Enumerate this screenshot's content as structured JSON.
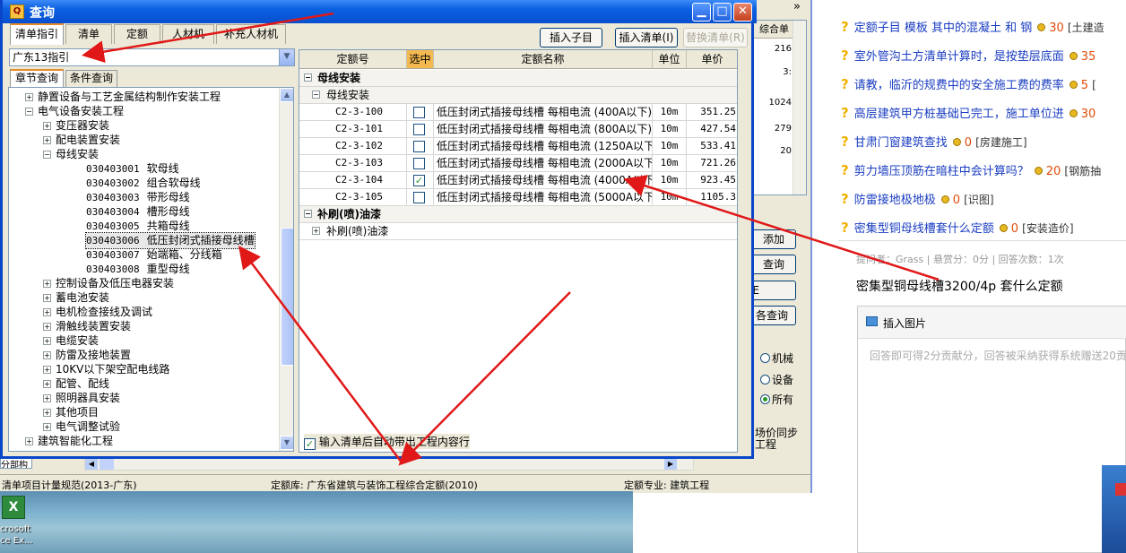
{
  "dialog": {
    "title": "查询",
    "tabs": [
      "清单指引",
      "清单",
      "定额",
      "人材机",
      "补充人材机"
    ],
    "buttons": {
      "insert_child": "插入子目",
      "insert_list": "插入清单(I)",
      "replace_list": "替换清单(R)"
    },
    "combo_value": "广东13指引",
    "subtabs": [
      "章节查询",
      "条件查询"
    ],
    "auto_check_label": "输入清单后自动带出工程内容行"
  },
  "tree": [
    {
      "label": "静置设备与工艺金属结构制作安装工程",
      "level": 1,
      "exp": "+"
    },
    {
      "label": "电气设备安装工程",
      "level": 1,
      "exp": "-"
    },
    {
      "label": "变压器安装",
      "level": 2,
      "exp": "+"
    },
    {
      "label": "配电装置安装",
      "level": 2,
      "exp": "+"
    },
    {
      "label": "母线安装",
      "level": 2,
      "exp": "-"
    },
    {
      "code": "030403001",
      "label": "软母线",
      "level": 3
    },
    {
      "code": "030403002",
      "label": "组合软母线",
      "level": 3
    },
    {
      "code": "030403003",
      "label": "带形母线",
      "level": 3
    },
    {
      "code": "030403004",
      "label": "槽形母线",
      "level": 3
    },
    {
      "code": "030403005",
      "label": "共箱母线",
      "level": 3
    },
    {
      "code": "030403006",
      "label": "低压封闭式插接母线槽",
      "level": 3,
      "selected": true
    },
    {
      "code": "030403007",
      "label": "始端箱、分线箱",
      "level": 3
    },
    {
      "code": "030403008",
      "label": "重型母线",
      "level": 3
    },
    {
      "label": "控制设备及低压电器安装",
      "level": 2,
      "exp": "+"
    },
    {
      "label": "蓄电池安装",
      "level": 2,
      "exp": "+"
    },
    {
      "label": "电机检查接线及调试",
      "level": 2,
      "exp": "+"
    },
    {
      "label": "滑触线装置安装",
      "level": 2,
      "exp": "+"
    },
    {
      "label": "电缆安装",
      "level": 2,
      "exp": "+"
    },
    {
      "label": "防雷及接地装置",
      "level": 2,
      "exp": "+"
    },
    {
      "label": "10KV以下架空配电线路",
      "level": 2,
      "exp": "+"
    },
    {
      "label": "配管、配线",
      "level": 2,
      "exp": "+"
    },
    {
      "label": "照明器具安装",
      "level": 2,
      "exp": "+"
    },
    {
      "label": "其他项目",
      "level": 2,
      "exp": "+"
    },
    {
      "label": "电气调整试验",
      "level": 2,
      "exp": "+"
    },
    {
      "label": "建筑智能化工程",
      "level": 1,
      "exp": "+"
    }
  ],
  "grid": {
    "headers": [
      "定额号",
      "选中",
      "定额名称",
      "单位",
      "单价"
    ],
    "group1": "母线安装",
    "subgroup1": "母线安装",
    "rows": [
      {
        "code": "C2-3-100",
        "checked": false,
        "name": "低压封闭式插接母线槽 每相电流 (400A以下)",
        "unit": "10m",
        "price": "351.25"
      },
      {
        "code": "C2-3-101",
        "checked": false,
        "name": "低压封闭式插接母线槽 每相电流 (800A以下)",
        "unit": "10m",
        "price": "427.54"
      },
      {
        "code": "C2-3-102",
        "checked": false,
        "name": "低压封闭式插接母线槽 每相电流 (1250A以下)",
        "unit": "10m",
        "price": "533.41"
      },
      {
        "code": "C2-3-103",
        "checked": false,
        "name": "低压封闭式插接母线槽 每相电流 (2000A以下)",
        "unit": "10m",
        "price": "721.26"
      },
      {
        "code": "C2-3-104",
        "checked": true,
        "name": "低压封闭式插接母线槽 每相电流 (4000A以下)",
        "unit": "10m",
        "price": "923.45"
      },
      {
        "code": "C2-3-105",
        "checked": false,
        "name": "低压封闭式插接母线槽 每相电流 (5000A以下)",
        "unit": "10m",
        "price": "1105.3"
      }
    ],
    "group2": "补刷(喷)油漆",
    "subgroup2": "补刷(喷)油漆"
  },
  "bgapp": {
    "col_header": "综合单",
    "values": [
      "216",
      "3:",
      "1024",
      "279",
      "20"
    ],
    "buttons": [
      "添加",
      "查询",
      "E",
      "各查询"
    ],
    "radios": [
      {
        "label": "机械",
        "on": false
      },
      {
        "label": "设备",
        "on": false
      },
      {
        "label": "所有",
        "on": true
      }
    ],
    "sync_text": [
      "场价同步",
      "工程"
    ],
    "status": {
      "left": "清单项目计量规范(2013-广东)",
      "mid": "定额库: 广东省建筑与装饰工程综合定额(2010)",
      "right": "定额专业: 建筑工程"
    },
    "tree_tab": "分部构"
  },
  "desktop": {
    "icon_label": [
      "crosoft",
      "ce Ex..."
    ]
  },
  "qa": [
    {
      "title": "定额子目 模板 其中的混凝土 和 钢",
      "score": "30",
      "tag": "[土建造"
    },
    {
      "title": "室外管沟土方清单计算时，是按垫层底面",
      "score": "35",
      "tag": ""
    },
    {
      "title": "请教，临沂的规费中的安全施工费的费率",
      "score": "5",
      "tag": "["
    },
    {
      "title": "高层建筑甲方桩基础已完工，施工单位进",
      "score": "30",
      "tag": ""
    },
    {
      "title": "甘肃门窗建筑查找",
      "score": "0",
      "tag": "[房建施工]"
    },
    {
      "title": "剪力墙压顶筋在暗柱中会计算吗？",
      "score": "20",
      "tag": "[钢筋抽"
    },
    {
      "title": "防雷接地极地极",
      "score": "0",
      "tag": "[识图]"
    },
    {
      "title": "密集型铜母线槽套什么定额",
      "score": "0",
      "tag": "[安装造价]"
    }
  ],
  "question": {
    "meta": "提问者：Grass   |   悬赏分：0分   |   回答次数：1次",
    "text": "密集型铜母线槽3200/4p 套什么定额",
    "insert_image": "插入图片",
    "placeholder": "回答即可得2分贡献分，回答被采纳获得系统赠送20贡"
  }
}
